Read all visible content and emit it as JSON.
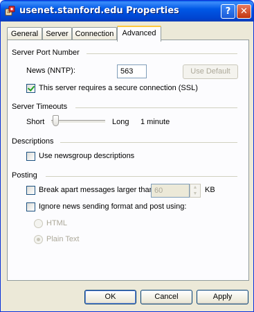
{
  "window": {
    "title": "usenet.stanford.edu Properties",
    "help_label": "?",
    "close_label": "✕"
  },
  "tabs": [
    {
      "label": "General",
      "active": false
    },
    {
      "label": "Server",
      "active": false
    },
    {
      "label": "Connection",
      "active": false
    },
    {
      "label": "Advanced",
      "active": true
    }
  ],
  "server_port": {
    "group_title": "Server Port Number",
    "news_label": "News (NNTP):",
    "port_value": "563",
    "use_default_label": "Use Default",
    "ssl_label": "This server requires a secure connection (SSL)",
    "ssl_checked": true
  },
  "timeouts": {
    "group_title": "Server Timeouts",
    "short_label": "Short",
    "long_label": "Long",
    "value_text": "1 minute",
    "slider_level": 0.08
  },
  "descriptions": {
    "group_title": "Descriptions",
    "use_desc_label": "Use newsgroup descriptions",
    "use_desc_checked": false
  },
  "posting": {
    "group_title": "Posting",
    "break_label": "Break apart messages larger than",
    "break_checked": false,
    "break_value": "60",
    "kb_label": "KB",
    "ignore_label": "Ignore news sending format and post using:",
    "ignore_checked": false,
    "html_label": "HTML",
    "plain_label": "Plain Text",
    "selected_format": "Plain Text"
  },
  "buttons": {
    "ok": "OK",
    "cancel": "Cancel",
    "apply": "Apply"
  },
  "colors": {
    "titlebar": "#0058e6",
    "dialog_bg": "#ece9d8",
    "panel_bg": "#fcfcfe",
    "active_tab_accent": "#ffc83c",
    "check_mark": "#21a121"
  },
  "icons": {
    "title": "newsgroup-server-icon"
  }
}
